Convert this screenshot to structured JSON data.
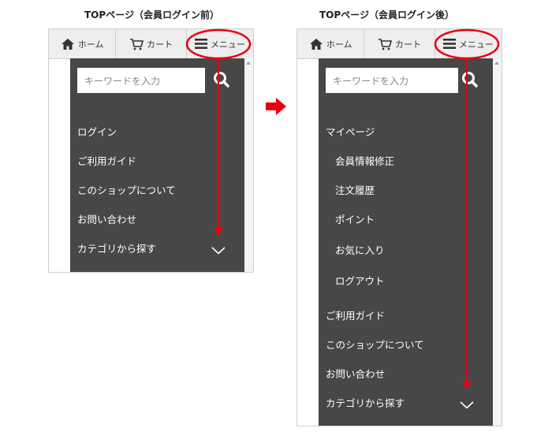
{
  "captions": {
    "before": "TOPページ（会員ログイン前）",
    "after": "TOPページ（会員ログイン後）"
  },
  "nav": {
    "home": "ホーム",
    "cart": "カート",
    "menu": "メニュー"
  },
  "search": {
    "placeholder": "キーワードを入力"
  },
  "before_menu": {
    "login": "ログイン",
    "guide": "ご利用ガイド",
    "about": "このショップについて",
    "contact": "お問い合わせ",
    "category": "カテゴリから探す"
  },
  "after_menu": {
    "mypage": "マイページ",
    "member_edit": "会員情報修正",
    "order_history": "注文履歴",
    "points": "ポイント",
    "favorites": "お気に入り",
    "logout": "ログアウト",
    "guide": "ご利用ガイド",
    "about": "このショップについて",
    "contact": "お問い合わせ",
    "category": "カテゴリから探す"
  },
  "colors": {
    "annotation_red": "#e60012",
    "panel_bg": "#474747",
    "nav_bg": "#eeeeee"
  },
  "icons": [
    "home-icon",
    "cart-icon",
    "hamburger-icon",
    "search-icon",
    "chevron-down-icon",
    "right-arrow-icon"
  ]
}
